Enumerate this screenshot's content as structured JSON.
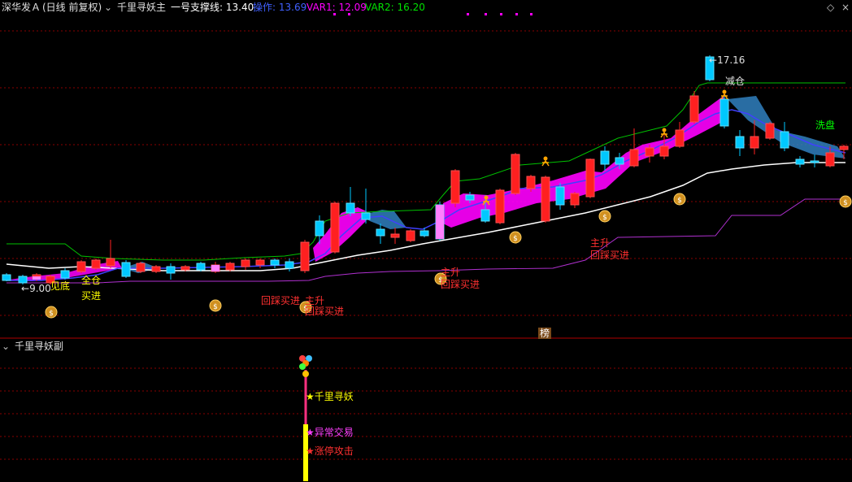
{
  "header": {
    "stock_name": "深华发Ａ",
    "period": "(日线 前复权)",
    "indicator_main": "千里寻妖主",
    "support_label": "一号支撑线: 13.40",
    "operate_label": "操作: 13.69",
    "var1_label": "VAR1: 12.09",
    "var2_label": "VAR2: 16.20"
  },
  "sub_panel": {
    "title": "千里寻妖副",
    "signals": [
      "千里寻妖",
      "异常交易",
      "涨停攻击"
    ]
  },
  "annotations": {
    "high_price": "17.16",
    "low_price": "9.00",
    "jian_cang": "减仓",
    "xi_pan": "洗盘",
    "jian_di": "见底",
    "quan_cang": "全仓",
    "mai_jin": "买进",
    "zhu_sheng": "主升",
    "hui_cai_mai_jin": "回踩买进",
    "bang": "榜"
  },
  "colors": {
    "bg": "#000000",
    "up": "#ff2020",
    "down": "#00c8ff",
    "magenta": "#ff00ff",
    "green": "#00c000",
    "white": "#ffffff",
    "purple": "#b030d0",
    "grid": "#8a0000",
    "yellow": "#ffff00",
    "orange": "#ffa500"
  },
  "chart_data": {
    "type": "candlestick",
    "price_range": [
      8.5,
      17.6
    ],
    "series": [
      {
        "name": "一号支撑线"
      },
      {
        "name": "操作"
      },
      {
        "name": "VAR1"
      },
      {
        "name": "VAR2"
      }
    ]
  }
}
